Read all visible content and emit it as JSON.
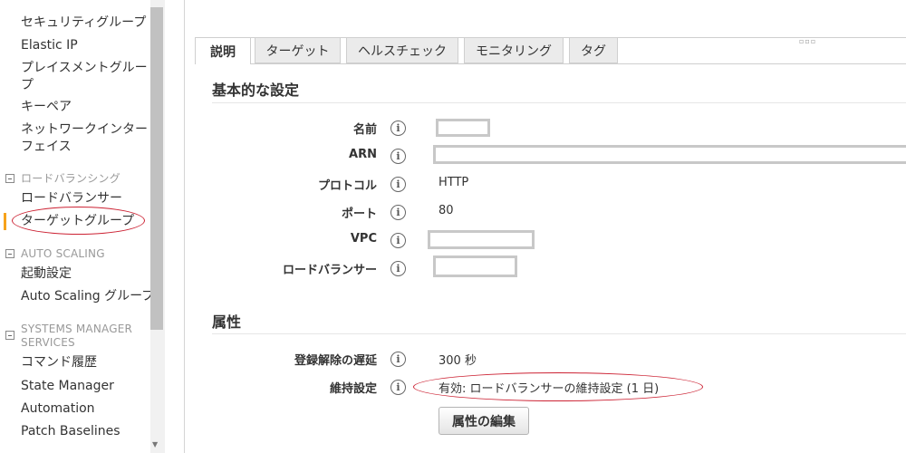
{
  "sidebar": {
    "partial_top": "",
    "items_top": [
      {
        "label": "セキュリティグループ"
      },
      {
        "label": "Elastic IP"
      },
      {
        "label": "プレイスメントグループ"
      },
      {
        "label": "キーペア"
      },
      {
        "label": "ネットワークインターフェイス"
      }
    ],
    "sections": {
      "load_balancing": {
        "title": "ロードバランシング",
        "items": [
          "ロードバランサー",
          "ターゲットグループ"
        ]
      },
      "auto_scaling": {
        "title": "AUTO SCALING",
        "items": [
          "起動設定",
          "Auto Scaling グループ"
        ]
      },
      "systems_manager": {
        "title": "SYSTEMS MANAGER SERVICES",
        "items": [
          "コマンド履歴",
          "State Manager",
          "Automation",
          "Patch Baselines"
        ]
      }
    },
    "active_item": "ターゲットグループ",
    "accent_color": "#f7a21b"
  },
  "tabs": [
    {
      "label": "説明",
      "active": true
    },
    {
      "label": "ターゲット",
      "active": false
    },
    {
      "label": "ヘルスチェック",
      "active": false
    },
    {
      "label": "モニタリング",
      "active": false
    },
    {
      "label": "タグ",
      "active": false
    }
  ],
  "basic": {
    "title": "基本的な設定",
    "fields": [
      {
        "label": "名前",
        "value": "",
        "redacted": true
      },
      {
        "label": "ARN",
        "value": "",
        "redacted": true
      },
      {
        "label": "プロトコル",
        "value": "HTTP",
        "redacted": false
      },
      {
        "label": "ポート",
        "value": "80",
        "redacted": false
      },
      {
        "label": "VPC",
        "value": "",
        "redacted": true
      },
      {
        "label": "ロードバランサー",
        "value": "",
        "redacted": true
      }
    ]
  },
  "attributes": {
    "title": "属性",
    "fields": [
      {
        "label": "登録解除の遅延",
        "value": "300 秒"
      },
      {
        "label": "維持設定",
        "value": "有効: ロードバランサーの維持設定 (1 日)"
      }
    ],
    "edit_button": "属性の編集"
  },
  "info_icon_glyph": "i",
  "annotation_color": "#cc2233"
}
